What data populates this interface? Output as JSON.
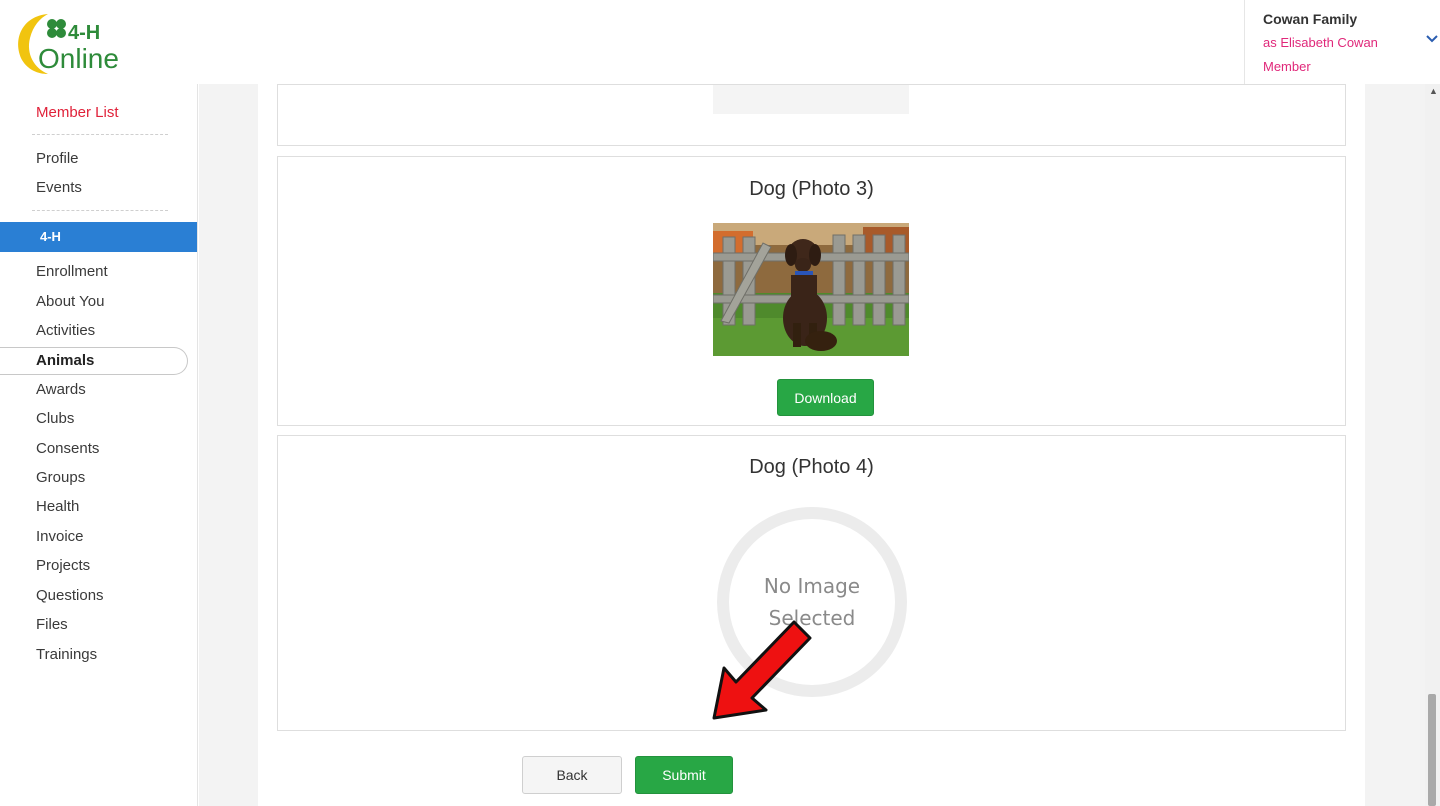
{
  "header": {
    "logo_text_top": "4-H",
    "logo_text_bottom": "Online",
    "user": {
      "family": "Cowan Family",
      "as_name": "as Elisabeth Cowan",
      "role": "Member"
    }
  },
  "sidebar": {
    "member_list": "Member List",
    "profile": "Profile",
    "events": "Events",
    "section": "4-H",
    "items": [
      "Enrollment",
      "About You",
      "Activities",
      "Animals",
      "Awards",
      "Clubs",
      "Consents",
      "Groups",
      "Health",
      "Invoice",
      "Projects",
      "Questions",
      "Files",
      "Trainings"
    ],
    "active": "Animals"
  },
  "main": {
    "photo3": {
      "title": "Dog (Photo 3)",
      "download_label": "Download"
    },
    "photo4": {
      "title": "Dog (Photo 4)",
      "no_image_line1": "No Image",
      "no_image_line2": "Selected"
    },
    "back_label": "Back",
    "submit_label": "Submit"
  },
  "colors": {
    "accent_blue": "#2a7fd4",
    "member_list_red": "#e0223a",
    "user_pink": "#e0287a",
    "button_green": "#28a745",
    "arrow_red": "#ee1111"
  }
}
